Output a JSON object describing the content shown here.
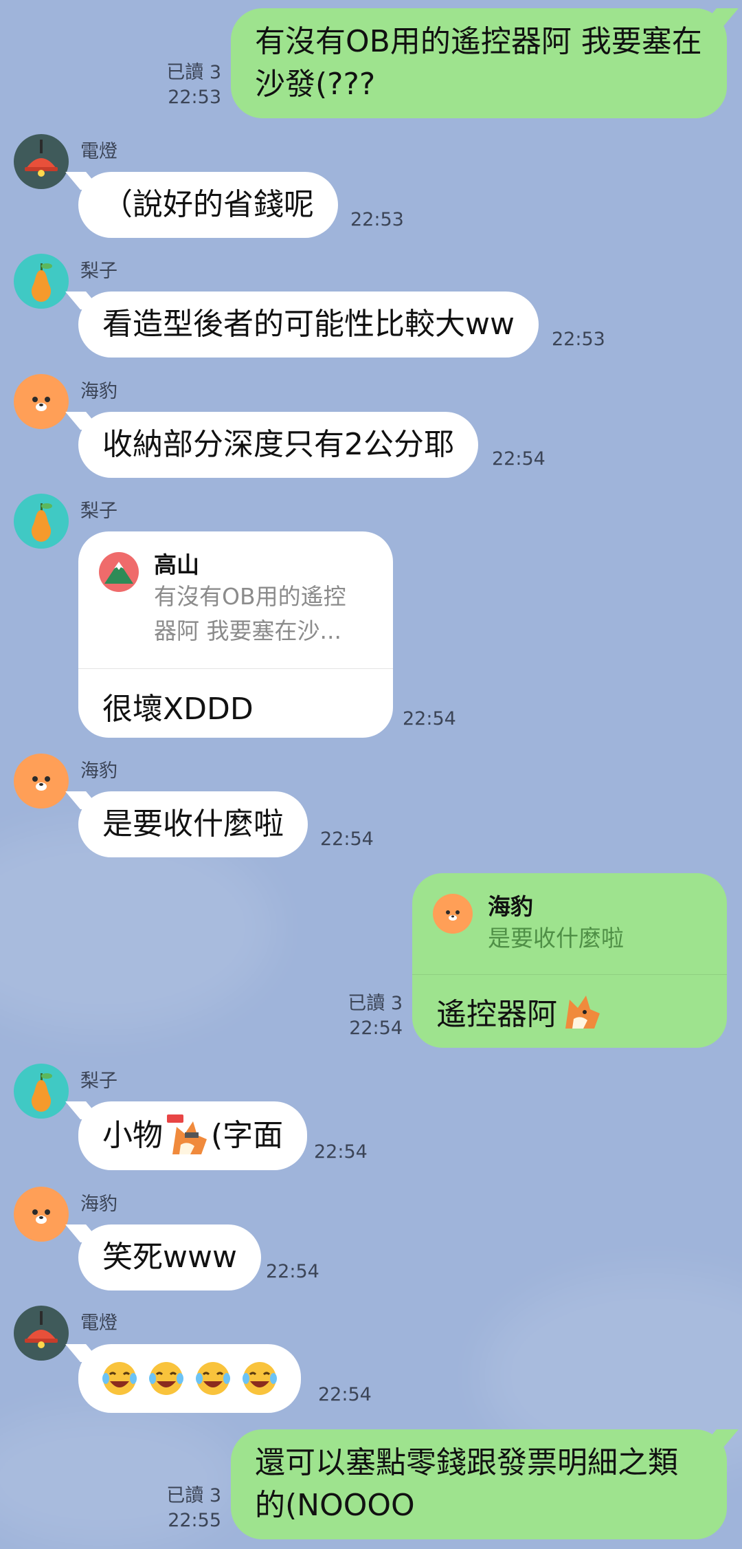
{
  "messages": {
    "m1": {
      "text": "有沒有OB用的遙控器阿 我要塞在沙發(???",
      "read": "已讀 3",
      "time": "22:53"
    },
    "m2": {
      "sender": "電燈",
      "text": "（說好的省錢呢",
      "time": "22:53"
    },
    "m3": {
      "sender": "梨子",
      "text": "看造型後者的可能性比較大ww",
      "time": "22:53"
    },
    "m4": {
      "sender": "海豹",
      "text": "收納部分深度只有2公分耶",
      "time": "22:54"
    },
    "m5": {
      "sender": "梨子",
      "quote_name": "高山",
      "quote_text": "有沒有OB用的遙控器阿 我要塞在沙...",
      "text": "很壞XDDD",
      "time": "22:54"
    },
    "m6": {
      "sender": "海豹",
      "text": "是要收什麼啦",
      "time": "22:54"
    },
    "m7": {
      "quote_name": "海豹",
      "quote_text": "是要收什麼啦",
      "text": "遙控器阿",
      "read": "已讀 3",
      "time": "22:54"
    },
    "m8": {
      "sender": "梨子",
      "text_before": "小物",
      "text_after": "(字面",
      "time": "22:54"
    },
    "m9": {
      "sender": "海豹",
      "text": "笑死www",
      "time": "22:54"
    },
    "m10": {
      "sender": "電燈",
      "emoji_count": 4,
      "time": "22:54"
    },
    "m11": {
      "text": "還可以塞點零錢跟發票明細之類的(NOOOO",
      "read": "已讀 3",
      "time": "22:55"
    }
  },
  "colors": {
    "background": "#9fb4da",
    "outgoing_bubble": "#9ee38e",
    "incoming_bubble": "#ffffff",
    "lamp_avatar_bg": "#3f5a5a",
    "pear_avatar_bg": "#40c9c4",
    "seal_avatar_bg": "#ff9f57"
  },
  "icons": {
    "lamp": "lamp-avatar-icon",
    "pear": "pear-avatar-icon",
    "seal": "seal-avatar-icon",
    "mountain": "mountain-avatar-icon",
    "fox": "fox-sticker-icon",
    "laugh": "laughing-tears-emoji-icon"
  }
}
